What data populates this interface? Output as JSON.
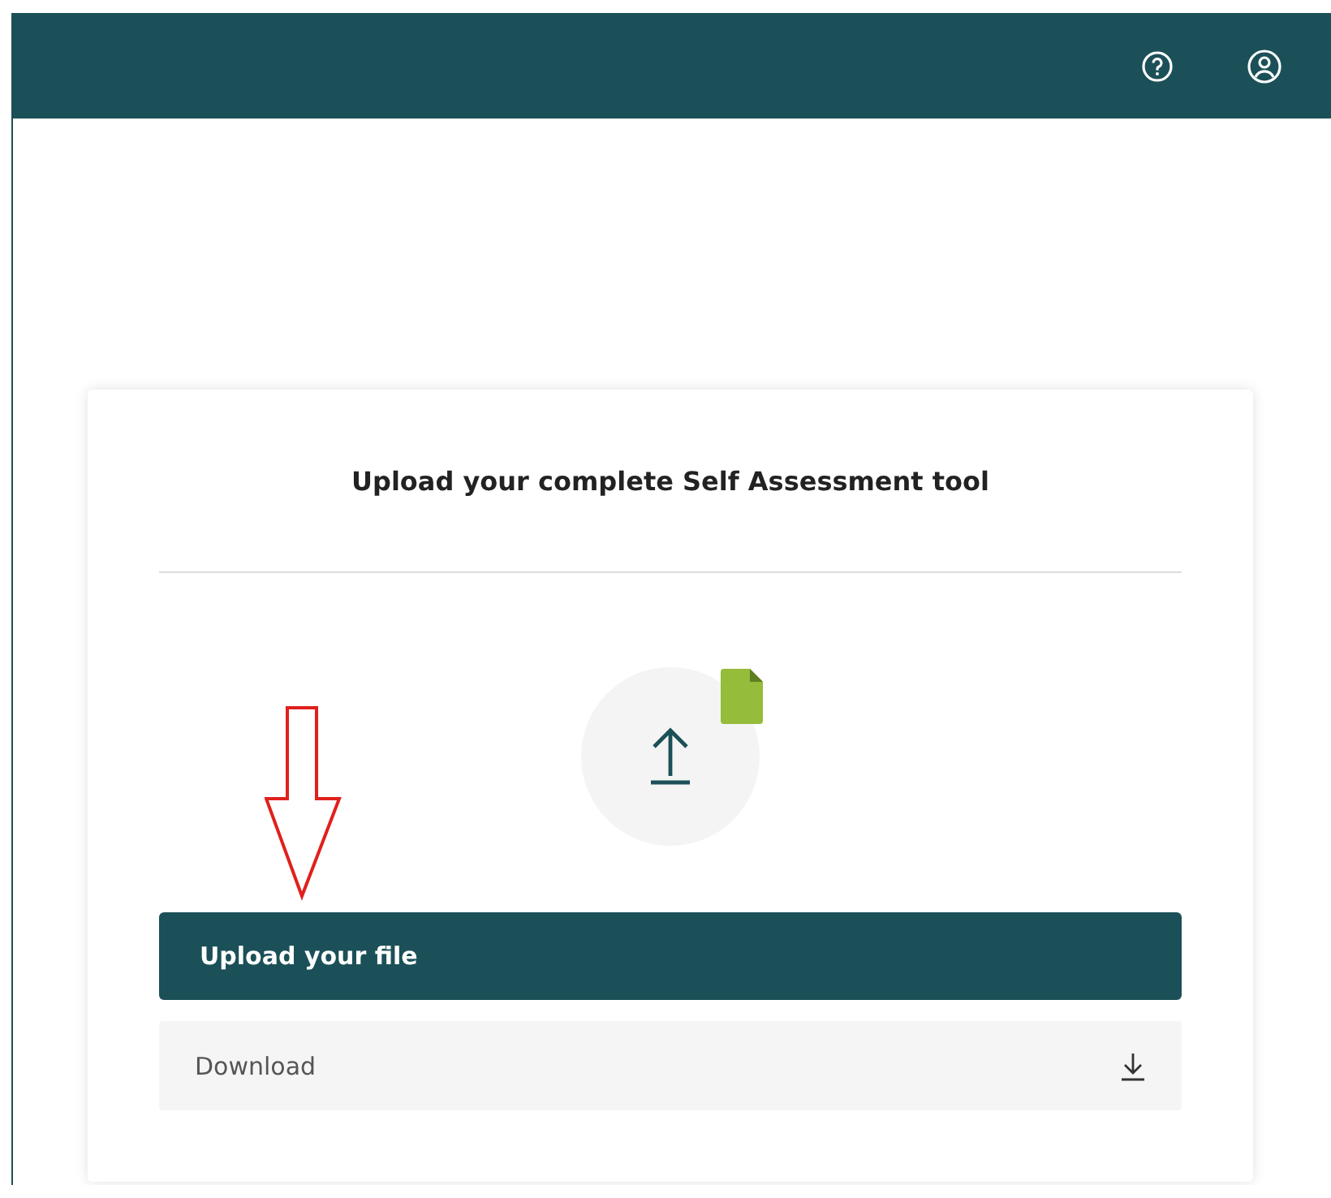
{
  "header": {
    "actions": [
      {
        "kind": "help"
      },
      {
        "kind": "account"
      }
    ]
  },
  "card": {
    "title": "Upload your complete Self Assessment tool",
    "upload_button": {
      "label": "Upload your file"
    },
    "download": {
      "label": "Download"
    }
  }
}
